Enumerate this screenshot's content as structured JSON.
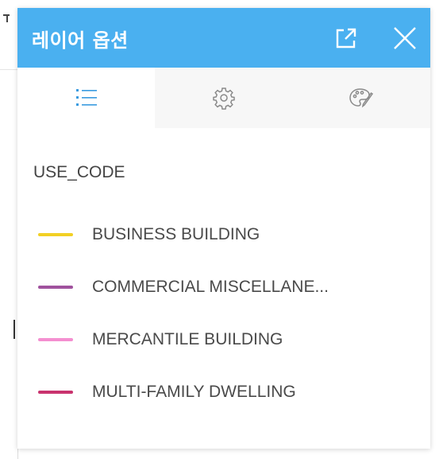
{
  "panel": {
    "title": "레이어 옵션",
    "popout_icon": "popout-icon",
    "close_icon": "close-icon",
    "header_color": "#4ab0f0"
  },
  "tabs": [
    {
      "icon": "list-icon",
      "active": true
    },
    {
      "icon": "gear-icon",
      "active": false
    },
    {
      "icon": "palette-icon",
      "active": false
    }
  ],
  "legend": {
    "field_name": "USE_CODE",
    "items": [
      {
        "label": "BUSINESS BUILDING",
        "color": "#f2d024"
      },
      {
        "label": "COMMERCIAL MISCELLANE...",
        "color": "#a0529e"
      },
      {
        "label": "MERCANTILE BUILDING",
        "color": "#f48fd0"
      },
      {
        "label": "MULTI-FAMILY DWELLING",
        "color": "#c9336e"
      }
    ]
  }
}
